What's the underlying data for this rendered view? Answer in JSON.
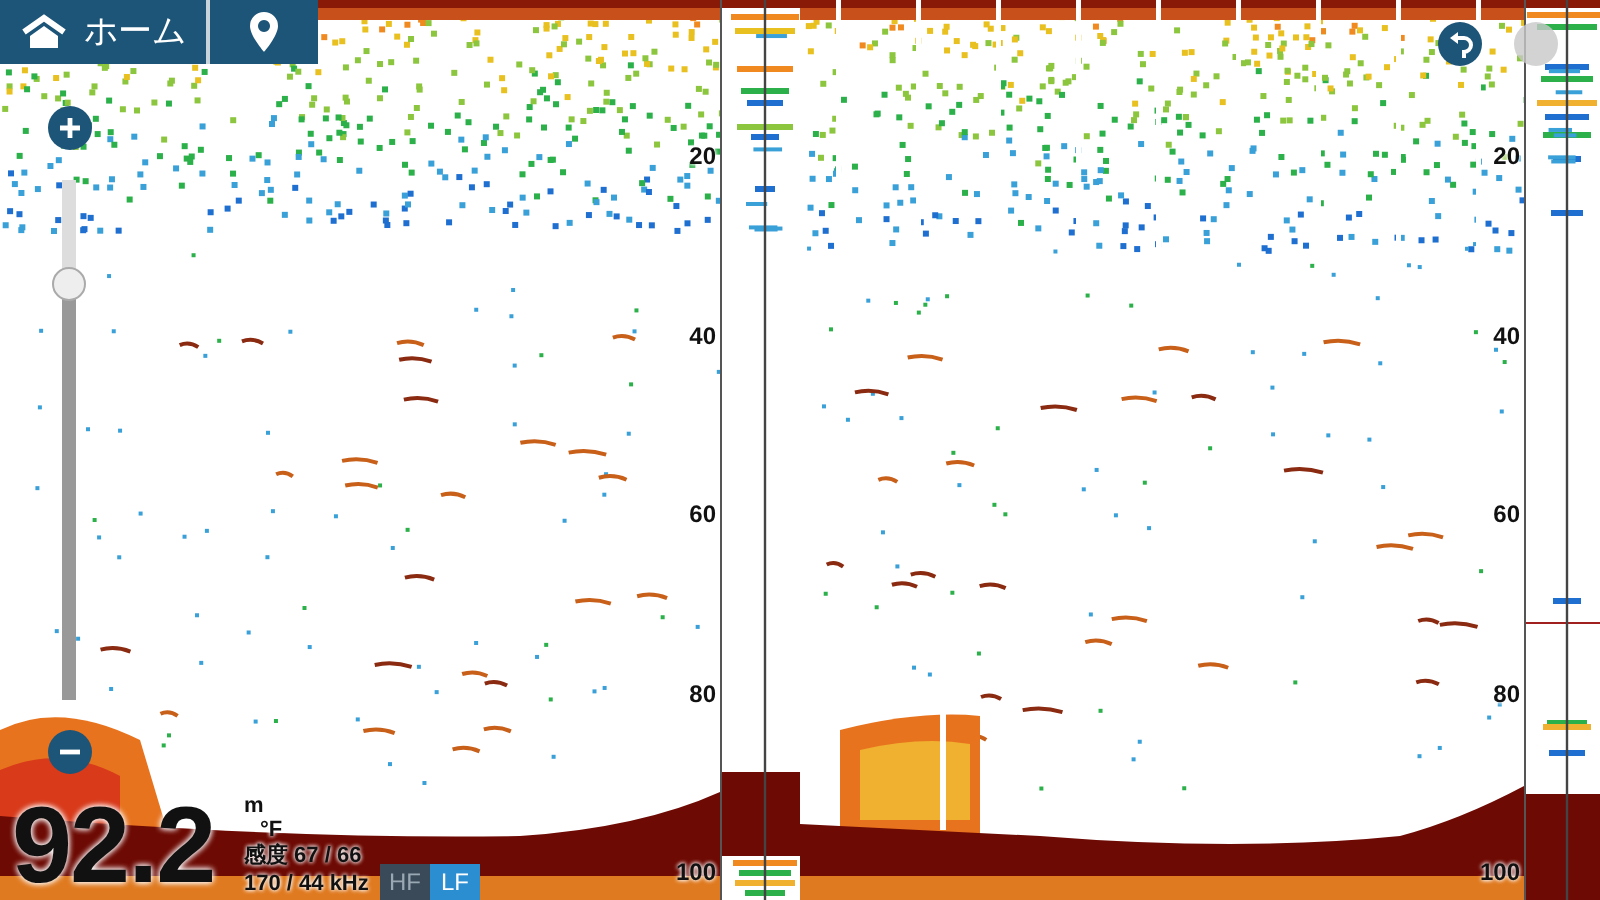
{
  "nav": {
    "home_label": "ホーム"
  },
  "panes": [
    {
      "scale": [
        "20",
        "40",
        "60",
        "80",
        "100"
      ]
    },
    {
      "scale": [
        "20",
        "40",
        "60",
        "80",
        "100"
      ]
    }
  ],
  "zoom": {
    "level": 0.8
  },
  "readout": {
    "depth": "92.2",
    "depth_unit": "m",
    "temp_unit": "°F",
    "gain": "感度 67 / 66",
    "frequency": "170 / 44 kHz"
  },
  "freq_tabs": [
    {
      "label": "HF",
      "selected": false
    },
    {
      "label": "LF",
      "selected": true
    }
  ],
  "round_buttons": [
    {
      "kind": "undo",
      "disabled": false
    },
    {
      "kind": "blank",
      "disabled": true
    }
  ]
}
